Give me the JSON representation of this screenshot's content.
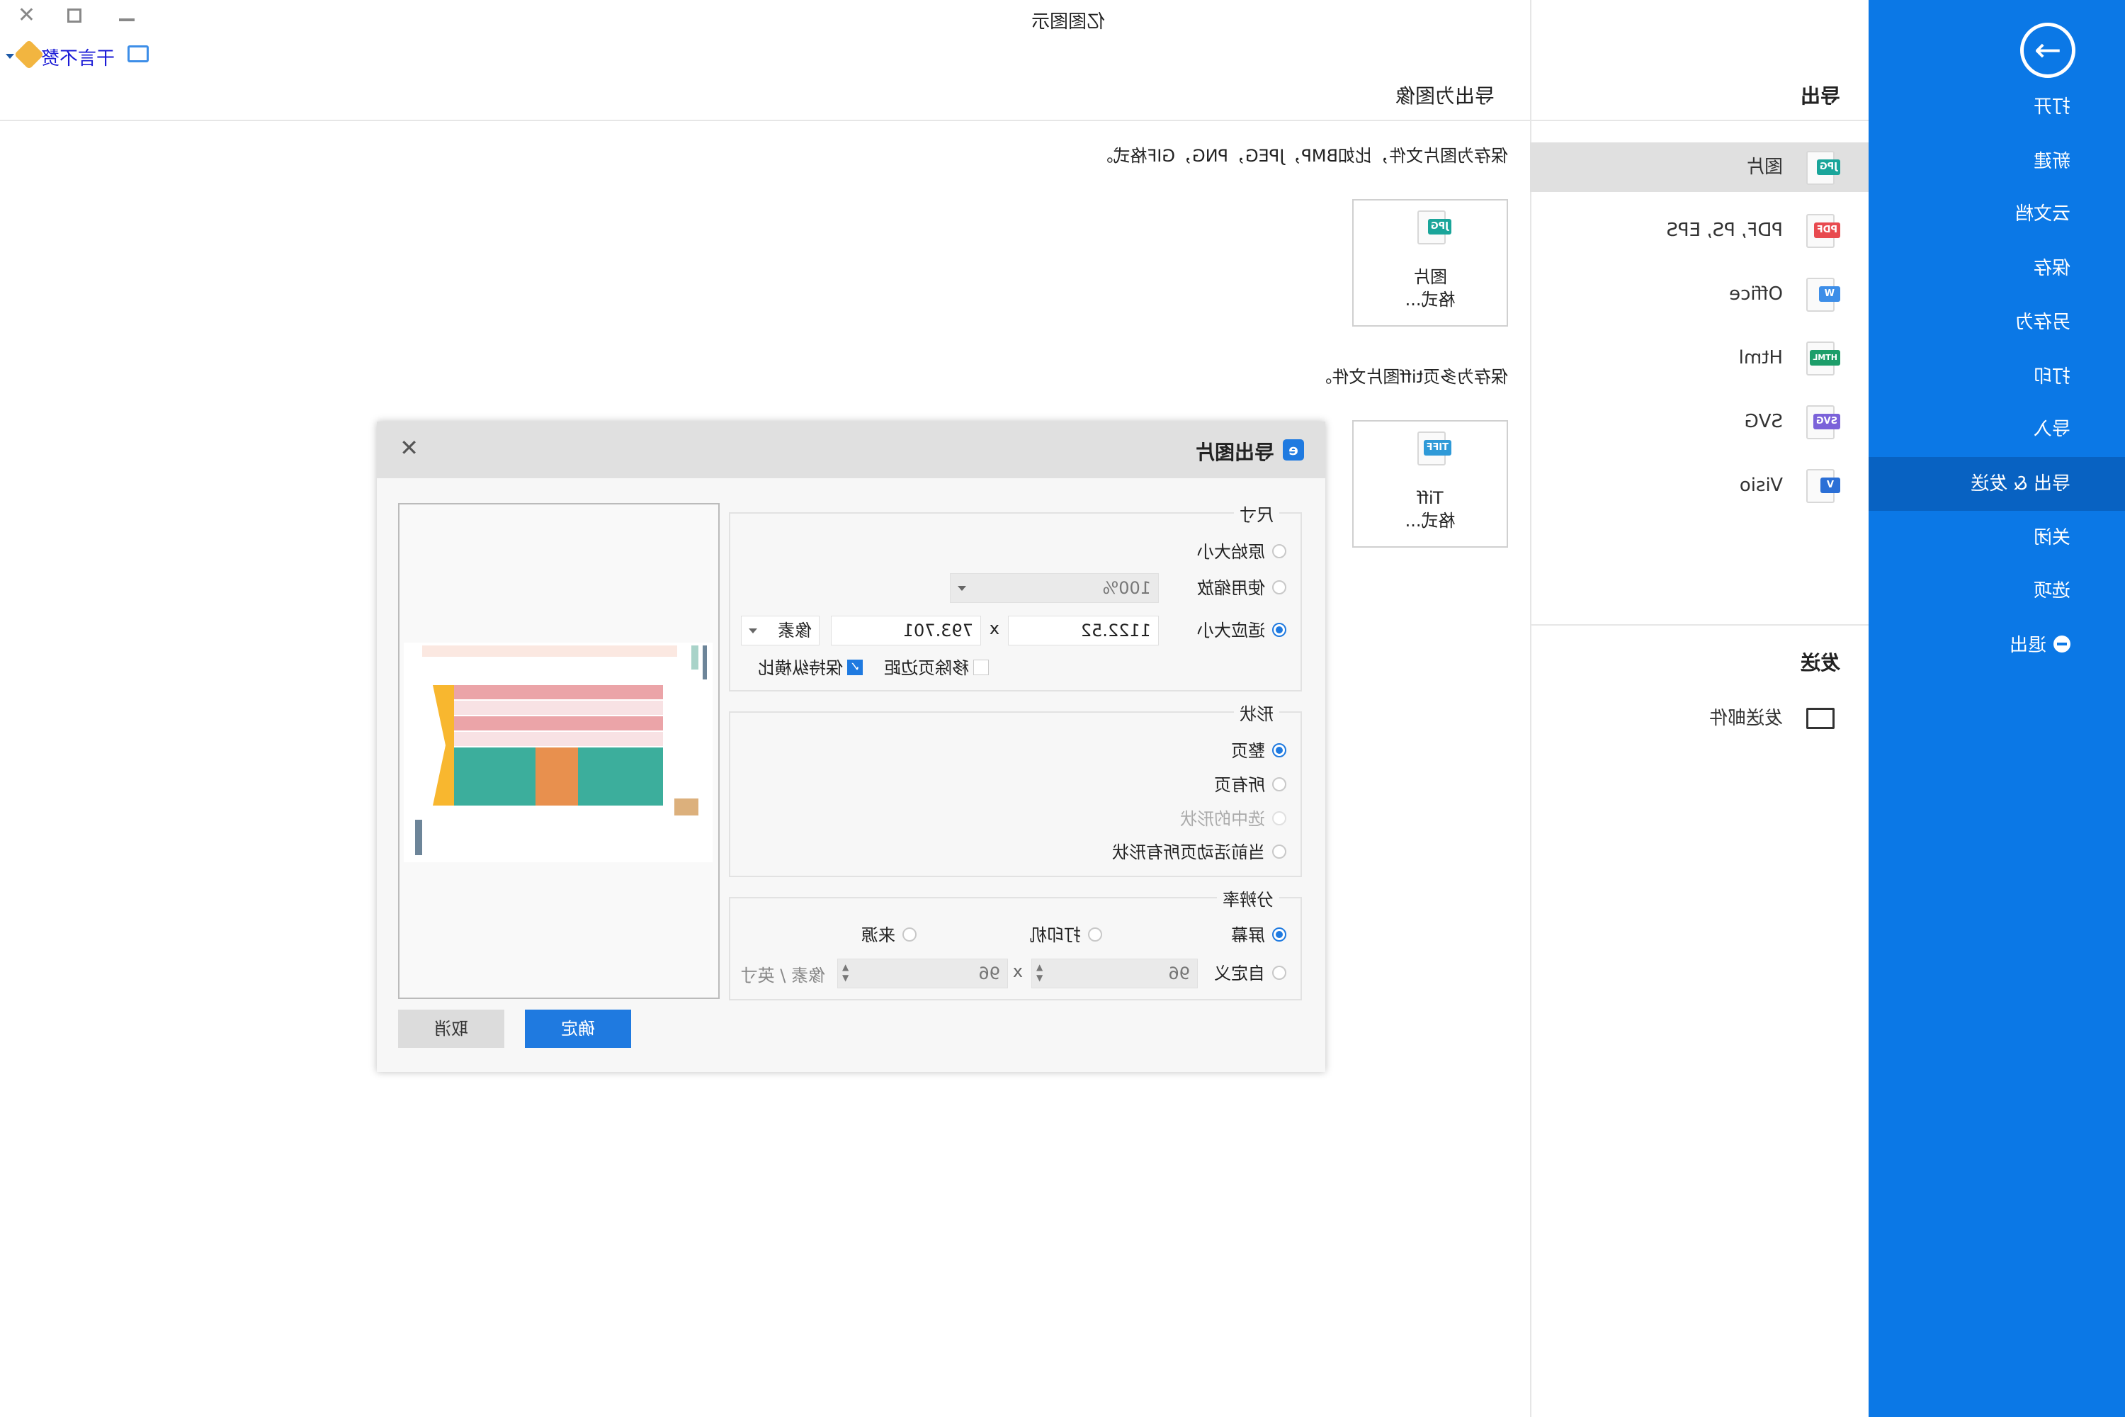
{
  "window": {
    "title": "亿图图示",
    "user": "干言不赘"
  },
  "sidebar": {
    "items": [
      {
        "label": "打开"
      },
      {
        "label": "新建"
      },
      {
        "label": "云文档"
      },
      {
        "label": "保存"
      },
      {
        "label": "另存为"
      },
      {
        "label": "打印"
      },
      {
        "label": "导入"
      },
      {
        "label": "导出 & 发送",
        "active": true
      },
      {
        "label": "关闭"
      },
      {
        "label": "选项"
      },
      {
        "label": "退出"
      }
    ],
    "color": "#0b78e6",
    "active_color": "#0862c2"
  },
  "middle": {
    "export_title": "导出",
    "items": [
      {
        "label": "图片",
        "badge": "JPG",
        "color": "#1aa59a",
        "selected": true
      },
      {
        "label": "PDF, PS, EPS",
        "badge": "PDF",
        "color": "#e84a4f"
      },
      {
        "label": "Office",
        "badge": "W",
        "color": "#3d8ee8"
      },
      {
        "label": "Html",
        "badge": "HTML",
        "color": "#1d9e6a"
      },
      {
        "label": "SVG",
        "badge": "SVG",
        "color": "#7b62d9"
      },
      {
        "label": "Visio",
        "badge": "V",
        "color": "#2b6fd6"
      }
    ],
    "send_title": "发送",
    "send_items": [
      {
        "label": "发送邮件"
      }
    ]
  },
  "content": {
    "title": "导出为图像",
    "desc1": "保存为图片文件，比如BMP，JPEG，PNG，GIF格式。",
    "card1": {
      "badge": "JPG",
      "line1": "图片",
      "line2": "格式..."
    },
    "desc2": "保存为多页tiff图片文件。",
    "card2": {
      "badge": "TIFF",
      "line1": "Tiff",
      "line2": "格式..."
    }
  },
  "dialog": {
    "title": "导出图片",
    "size": {
      "label": "尺寸",
      "original": "原始大小",
      "use_zoom": "使用缩放",
      "zoom_value": "100%",
      "fit": "适应大小",
      "width": "1122.52",
      "x": "x",
      "height": "793.701",
      "unit": "像素",
      "remove_margin": "移除页边距",
      "remove_margin_checked": false,
      "keep_ratio": "保持纵横比",
      "keep_ratio_checked": true,
      "selected": "fit"
    },
    "shape": {
      "label": "形状",
      "whole_page": "整页",
      "all_pages": "所有页",
      "selected_shapes": "选中的形状",
      "active_page_all": "当前活动页所有形状",
      "selected": "whole_page"
    },
    "resolution": {
      "label": "分辨率",
      "screen": "屏幕",
      "printer": "打印机",
      "source": "来源",
      "custom": "自定义",
      "dpi_x": "96",
      "x": "x",
      "dpi_y": "96",
      "unit": "像素 / 英寸",
      "selected": "screen"
    },
    "ok": "确定",
    "cancel": "取消"
  }
}
